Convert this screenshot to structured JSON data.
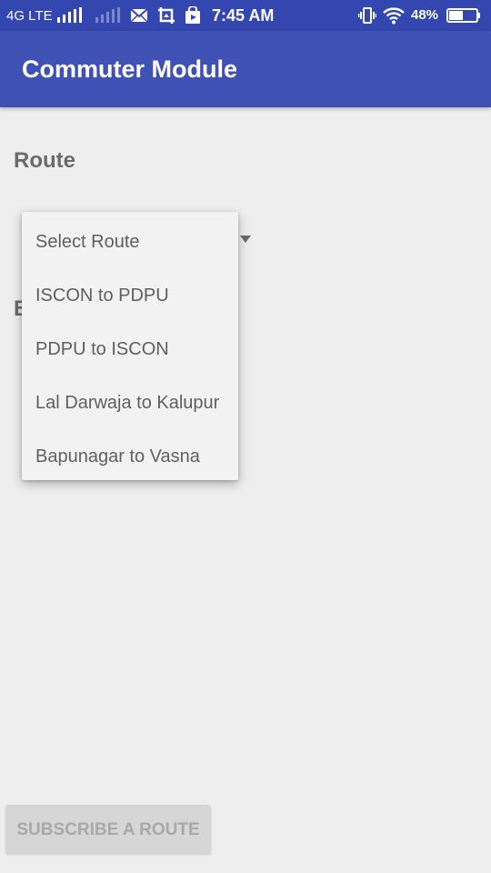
{
  "status_bar": {
    "network": "4G LTE",
    "time": "7:45 AM",
    "battery": "48%",
    "icons": [
      "signal-icon",
      "signal-weak-icon",
      "mail-icon",
      "screenshot-icon",
      "play-store-icon",
      "vibrate-icon",
      "wifi-icon",
      "battery-icon"
    ]
  },
  "app_bar": {
    "title": "Commuter Module"
  },
  "form": {
    "route_label": "Route",
    "second_label_visible_char": "B"
  },
  "route_dropdown": {
    "options": [
      "Select Route",
      "ISCON to PDPU",
      "PDPU to ISCON",
      "Lal Darwaja to Kalupur",
      "Bapunagar to Vasna"
    ]
  },
  "subscribe_button": {
    "label": "SUBSCRIBE A ROUTE",
    "enabled": false
  },
  "colors": {
    "status_bar": "#3447b1",
    "app_bar": "#3f51b5",
    "background": "#eeeeee"
  }
}
